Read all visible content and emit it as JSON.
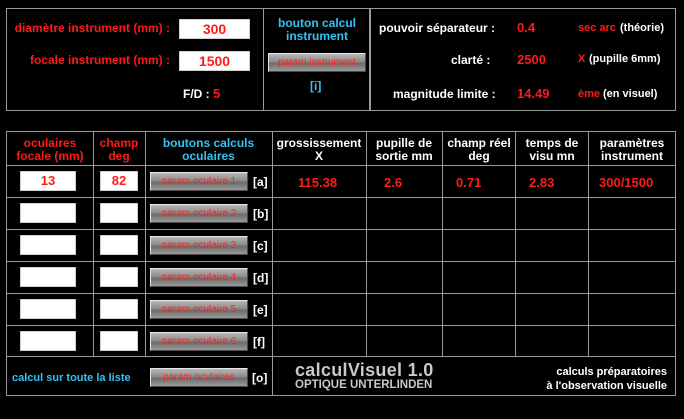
{
  "instrument": {
    "diameter_label": "diamètre instrument (mm) :",
    "diameter_value": "300",
    "focal_label": "focale instrument (mm) :",
    "focal_value": "1500",
    "fd_label": "F/D :",
    "fd_value": "5",
    "calc_title": "bouton calcul instrument",
    "calc_button": "param instrument",
    "calc_link": "[i]"
  },
  "results": {
    "resolving_label": "pouvoir séparateur :",
    "resolving_value": "0.4",
    "resolving_unit": "sec arc",
    "resolving_note": "(théorie)",
    "clarity_label": "clarté :",
    "clarity_value": "2500",
    "clarity_unit": "X",
    "clarity_note": "(pupille 6mm)",
    "magnitude_label": "magnitude limite :",
    "magnitude_value": "14.49",
    "magnitude_unit": "ème",
    "magnitude_note": "(en visuel)"
  },
  "table": {
    "headers": {
      "eyepieces": "oculaires focale (mm)",
      "field": "champ deg",
      "buttons": "boutons calculs oculaires",
      "magnification": "grossissement X",
      "exit_pupil": "pupille de sortie mm",
      "real_field": "champ réel deg",
      "view_time": "temps de visu mn",
      "params": "paramètres instrument"
    },
    "rows": [
      {
        "focal": "13",
        "field": "82",
        "button": "param oculaire 1",
        "link": "[a]",
        "magnification": "115.38",
        "pupil": "2.6",
        "real_field": "0.71",
        "time": "2.83",
        "params": "300/1500"
      },
      {
        "focal": "",
        "field": "",
        "button": "param oculaire 2",
        "link": "[b]",
        "magnification": "",
        "pupil": "",
        "real_field": "",
        "time": "",
        "params": ""
      },
      {
        "focal": "",
        "field": "",
        "button": "param oculaire 3",
        "link": "[c]",
        "magnification": "",
        "pupil": "",
        "real_field": "",
        "time": "",
        "params": ""
      },
      {
        "focal": "",
        "field": "",
        "button": "param oculaire 4",
        "link": "[d]",
        "magnification": "",
        "pupil": "",
        "real_field": "",
        "time": "",
        "params": ""
      },
      {
        "focal": "",
        "field": "",
        "button": "param oculaire 5",
        "link": "[e]",
        "magnification": "",
        "pupil": "",
        "real_field": "",
        "time": "",
        "params": ""
      },
      {
        "focal": "",
        "field": "",
        "button": "param oculaire 6",
        "link": "[f]",
        "magnification": "",
        "pupil": "",
        "real_field": "",
        "time": "",
        "params": ""
      }
    ]
  },
  "footer": {
    "calc_all_label": "calcul sur toute la liste",
    "calc_all_button": "param oculaires",
    "calc_all_link": "[o]",
    "app_title": "calculVisuel 1.0",
    "app_subtitle": "OPTIQUE UNTERLINDEN",
    "tagline_1": "calculs préparatoires",
    "tagline_2": "à l'observation visuelle"
  }
}
